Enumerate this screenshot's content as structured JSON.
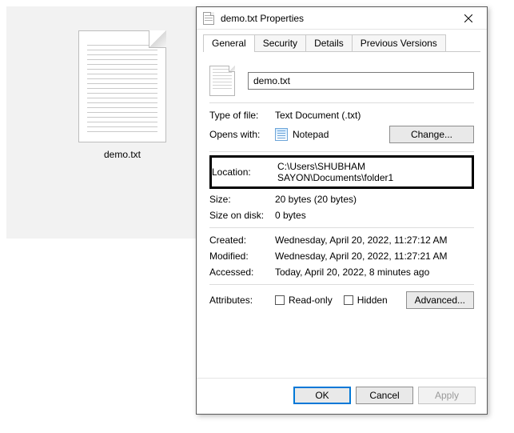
{
  "desktop": {
    "file_label": "demo.txt"
  },
  "dialog": {
    "title": "demo.txt Properties",
    "tabs": [
      "General",
      "Security",
      "Details",
      "Previous Versions"
    ],
    "filename": "demo.txt",
    "type_of_file_label": "Type of file:",
    "type_of_file_value": "Text Document (.txt)",
    "opens_with_label": "Opens with:",
    "opens_with_value": "Notepad",
    "change_button": "Change...",
    "location_label": "Location:",
    "location_value": "C:\\Users\\SHUBHAM SAYON\\Documents\\folder1",
    "size_label": "Size:",
    "size_value": "20 bytes (20 bytes)",
    "size_on_disk_label": "Size on disk:",
    "size_on_disk_value": "0 bytes",
    "created_label": "Created:",
    "created_value": "Wednesday, April 20, 2022, 11:27:12 AM",
    "modified_label": "Modified:",
    "modified_value": "Wednesday, April 20, 2022, 11:27:21 AM",
    "accessed_label": "Accessed:",
    "accessed_value": "Today, April 20, 2022, 8 minutes ago",
    "attributes_label": "Attributes:",
    "readonly_label": "Read-only",
    "hidden_label": "Hidden",
    "advanced_button": "Advanced...",
    "ok_button": "OK",
    "cancel_button": "Cancel",
    "apply_button": "Apply"
  }
}
